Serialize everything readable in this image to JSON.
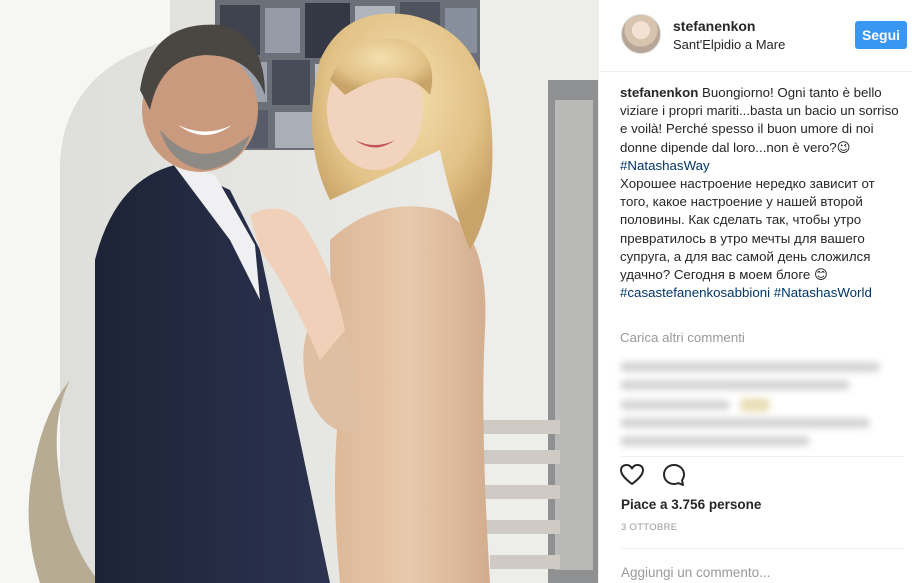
{
  "post": {
    "username": "stefanenkon",
    "location": "Sant'Elpidio a Mare",
    "follow_label": "Segui",
    "caption_user": "stefanenkon",
    "caption_it": "Buongiorno! Ogni tanto è bello viziare i propri mariti...basta un bacio un sorriso e voilà! Perché spesso il buon umore di noi donne dipende dal loro...non è vero?",
    "caption_emoji_1": "😉",
    "hashtag_1": "#NatashasWay",
    "caption_ru": "Хорошее настроение нередко зависит от того, какое настроение у нашей второй половины. Как сделать так, чтобы утро превратилось в утро мечты для вашего супруга, а для вас самой день сложился удачно? Сегодня в моем блоге",
    "caption_emoji_2": "😊",
    "hashtag_2": "#casastefanenkosabbioni",
    "hashtag_3": "#NatashasWorld",
    "load_more": "Carica altri commenti",
    "likes": "Piace a 3.756 persone",
    "date": "3 OTTOBRE",
    "comment_placeholder": "Aggiungi un commento..."
  },
  "icons": {
    "like": "heart-icon",
    "comment": "speech-bubble-icon"
  },
  "colors": {
    "follow_button": "#3897f0",
    "hashtag": "#003569",
    "muted": "#999999"
  }
}
